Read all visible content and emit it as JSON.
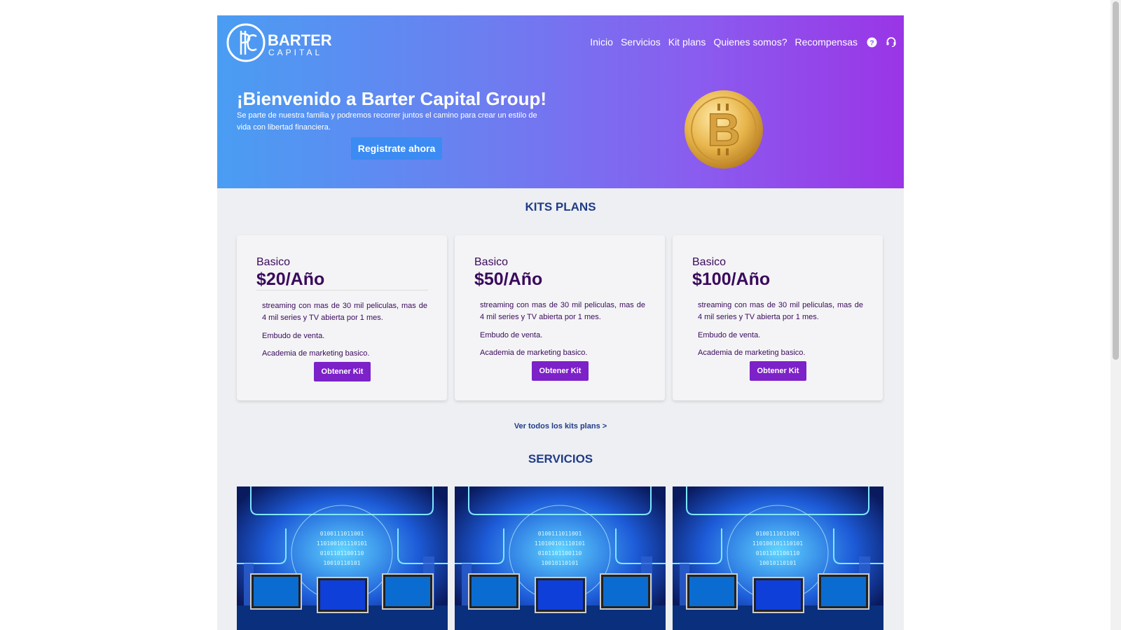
{
  "brand": {
    "name_line1": "BARTER",
    "name_line2": "CAPITAL",
    "monogram": "BC"
  },
  "nav": {
    "items": [
      "Inicio",
      "Servicios",
      "Kit plans",
      "Quienes somos?",
      "Recompensas"
    ],
    "help_icon": "question-circle-icon",
    "support_icon": "headset-icon"
  },
  "hero": {
    "title": "¡Bienvenido a Barter Capital Group!",
    "subtitle": "Se parte de nuestra familia y podremos recorrer juntos el camino para crear un estilo de vida con libertad financiera.",
    "cta": "Registrate ahora",
    "image": "bitcoin-coin"
  },
  "kits": {
    "title": "KITS PLANS",
    "cards": [
      {
        "name": "Basico",
        "price": "$20/Año",
        "features": [
          "streaming con mas de 30 mil peliculas, mas de 4 mil series y TV abierta por 1 mes.",
          "Embudo de venta.",
          "Academia de marketing basico."
        ],
        "button": "Obtener Kit"
      },
      {
        "name": "Basico",
        "price": "$50/Año",
        "features": [
          "streaming con mas de 30 mil peliculas, mas de 4 mil series y TV abierta por 1 mes.",
          "Embudo de venta.",
          "Academia de marketing basico."
        ],
        "button": "Obtener Kit"
      },
      {
        "name": "Basico",
        "price": "$100/Año",
        "features": [
          "streaming con mas de 30 mil peliculas, mas de 4 mil series y TV abierta por 1 mes.",
          "Embudo de venta.",
          "Academia de marketing basico."
        ],
        "button": "Obtener Kit"
      }
    ],
    "see_all": "Ver todos los kits plans >"
  },
  "services": {
    "title": "SERVICIOS",
    "images": [
      "digital-city-computers-image",
      "digital-city-computers-image",
      "digital-city-computers-image"
    ]
  },
  "colors": {
    "hero_gradient_start": "#4a9df3",
    "hero_gradient_end": "#9a35e6",
    "section_title": "#1f3c88",
    "card_text": "#3a0a5c",
    "kit_button": "#7c22c8",
    "cta_button": "#3b8bf2",
    "page_background": "#eeeff2"
  }
}
